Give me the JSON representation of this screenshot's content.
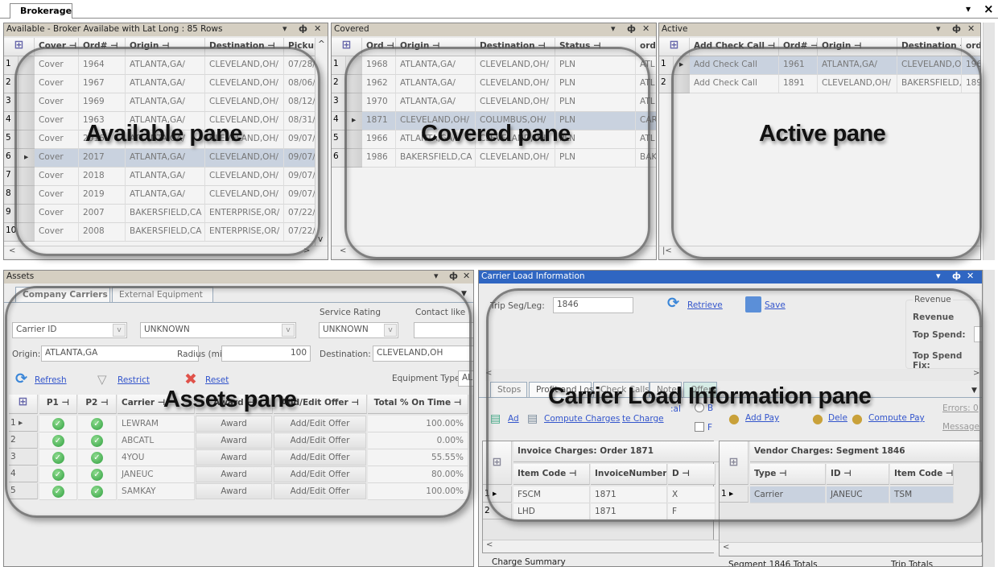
{
  "document_tab": "Brokerage",
  "window_controls": {
    "dropdown": "▾",
    "close": "×"
  },
  "pane_controls": {
    "menu": "▾",
    "pin": "ф",
    "close": "✕"
  },
  "available": {
    "title": "Available - Broker Availabe with Lat Long : 85 Rows",
    "columns": [
      "Cover",
      "Ord#",
      "Origin",
      "Destination",
      "Pickup"
    ],
    "selected_row": 6,
    "rows": [
      [
        "Cover",
        "1964",
        "ATLANTA,GA/",
        "CLEVELAND,OH/",
        "07/28/"
      ],
      [
        "Cover",
        "1967",
        "ATLANTA,GA/",
        "CLEVELAND,OH/",
        "08/06/"
      ],
      [
        "Cover",
        "1969",
        "ATLANTA,GA/",
        "CLEVELAND,OH/",
        "08/12/"
      ],
      [
        "Cover",
        "1963",
        "ATLANTA,GA/",
        "CLEVELAND,OH/",
        "08/31/"
      ],
      [
        "Cover",
        "2016",
        "ATLANTA,GA/",
        "CLEVELAND,OH/",
        "09/07/"
      ],
      [
        "Cover",
        "2017",
        "ATLANTA,GA/",
        "CLEVELAND,OH/",
        "09/07/"
      ],
      [
        "Cover",
        "2018",
        "ATLANTA,GA/",
        "CLEVELAND,OH/",
        "09/07/"
      ],
      [
        "Cover",
        "2019",
        "ATLANTA,GA/",
        "CLEVELAND,OH/",
        "09/07/"
      ],
      [
        "Cover",
        "2007",
        "BAKERSFIELD,CA",
        "ENTERPRISE,OR/",
        "07/22/"
      ],
      [
        "Cover",
        "2008",
        "BAKERSFIELD,CA",
        "ENTERPRISE,OR/",
        "07/22/"
      ]
    ]
  },
  "covered": {
    "title": "Covered",
    "columns": [
      "Ord",
      "Origin",
      "Destination",
      "Status",
      "ord"
    ],
    "selected_row": 4,
    "rows": [
      [
        "1968",
        "ATLANTA,GA/",
        "CLEVELAND,OH/",
        "PLN",
        "ATL"
      ],
      [
        "1962",
        "ATLANTA,GA/",
        "CLEVELAND,OH/",
        "PLN",
        "ATL"
      ],
      [
        "1970",
        "ATLANTA,GA/",
        "CLEVELAND,OH/",
        "PLN",
        "ATL"
      ],
      [
        "1871",
        "CLEVELAND,OH/",
        "COLUMBUS,OH/",
        "PLN",
        "CAR"
      ],
      [
        "1966",
        "ATLANTA,GA/",
        "CLEVELAND,OH/",
        "PLN",
        "ATL"
      ],
      [
        "1986",
        "BAKERSFIELD,CA",
        "CLEVELAND,OH/",
        "PLN",
        "BAK"
      ]
    ]
  },
  "active": {
    "title": "Active",
    "columns": [
      "Add Check Call",
      "Ord#",
      "Origin",
      "Destination",
      "ord"
    ],
    "selected_row": 1,
    "rows": [
      [
        "Add Check Call",
        "1961",
        "ATLANTA,GA/",
        "CLEVELAND,O",
        "196"
      ],
      [
        "Add Check Call",
        "1891",
        "CLEVELAND,OH/",
        "BAKERSFIELD,",
        "189"
      ]
    ]
  },
  "assets": {
    "title": "Assets",
    "tabs": [
      "Company Carriers",
      "External Equipment"
    ],
    "carrier_id_select": "Carrier ID",
    "unknown_select": "UNKNOWN",
    "service_rating_label": "Service Rating",
    "service_rating_value": "UNKNOWN",
    "contact_like_label": "Contact like",
    "origin_label": "Origin:",
    "origin_value": "ATLANTA,GA",
    "radius_label": "Radius (mi):",
    "radius_value": "100",
    "destination_label": "Destination:",
    "destination_value": "CLEVELAND,OH",
    "refresh": "Refresh",
    "restrict": "Restrict",
    "reset": "Reset",
    "equipment_type_label": "Equipment Type",
    "equipment_type_value": "AL",
    "columns": [
      "P1",
      "P2",
      "Carrier",
      "Award",
      "Add/Edit Offer",
      "Total % On Time"
    ],
    "rows": [
      {
        "carrier": "LEWRAM",
        "award": "Award",
        "offer": "Add/Edit Offer",
        "ontime": "100.00%"
      },
      {
        "carrier": "ABCATL",
        "award": "Award",
        "offer": "Add/Edit Offer",
        "ontime": "0.00%"
      },
      {
        "carrier": "4YOU",
        "award": "Award",
        "offer": "Add/Edit Offer",
        "ontime": "55.55%"
      },
      {
        "carrier": "JANEUC",
        "award": "Award",
        "offer": "Add/Edit Offer",
        "ontime": "80.00%"
      },
      {
        "carrier": "SAMKAY",
        "award": "Award",
        "offer": "Add/Edit Offer",
        "ontime": "100.00%"
      }
    ]
  },
  "carrier_load": {
    "title": "Carrier Load Information",
    "trip_label": "Trip Seg/Leg:",
    "trip_value": "1846",
    "retrieve": "Retrieve",
    "save": "Save",
    "revenue_group": "Revenue",
    "revenue_label": "Revenue",
    "top_spend_label": "Top Spend:",
    "top_spend_fix_label": "Top Spend Fix:",
    "tabs": [
      "Stops",
      "Profit and Loss",
      "Check Calls",
      "Notes",
      "Offers"
    ],
    "add": "Ad",
    "compute_charges": "Compute Charges",
    "delete_charge": "te Charge",
    "partial_label": ":al",
    "radio_label": "B",
    "check_label": "F",
    "add_pay": "Add Pay",
    "delete_pay": "Dele",
    "compute_pay": "Compute Pay",
    "errors": "Errors: 0",
    "messages": "Message",
    "invoice": {
      "title": "Invoice Charges: Order 1871",
      "columns": [
        "Item Code",
        "InvoiceNumber",
        "D"
      ],
      "rows": [
        [
          "FSCM",
          "1871",
          "X"
        ],
        [
          "LHD",
          "1871",
          "F"
        ]
      ]
    },
    "vendor": {
      "title": "Vendor Charges: Segment 1846",
      "columns": [
        "Type",
        "ID",
        "Item Code"
      ],
      "rows": [
        [
          "Carrier",
          "JANEUC",
          "TSM"
        ]
      ]
    },
    "charge_summary": "Charge Summary",
    "segment_totals": "Segment 1846 Totals",
    "trip_totals": "Trip Totals"
  },
  "annotations": {
    "available": "Available pane",
    "covered": "Covered pane",
    "active": "Active pane",
    "assets": "Assets pane",
    "carrier_load": "Carrier Load Information pane"
  },
  "colors": {
    "pane_header": "#d5cfc2",
    "active_header": "#2f66c2",
    "selected_row": "#c9d2df",
    "link": "#3355cc"
  }
}
